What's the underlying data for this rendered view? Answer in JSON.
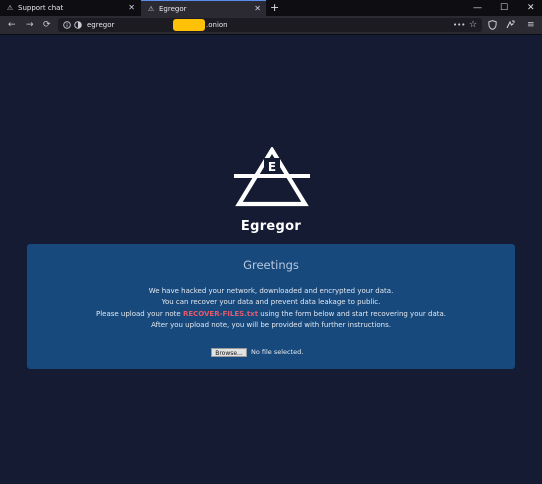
{
  "browser": {
    "tabs": [
      {
        "title": "Support chat",
        "icon": "warning-icon",
        "active": false
      },
      {
        "title": "Egregor",
        "icon": "warning-icon",
        "active": true
      }
    ],
    "new_tab_label": "+",
    "window_controls": {
      "minimize": "—",
      "maximize": "☐",
      "close": "✕"
    },
    "nav": {
      "back": "←",
      "forward": "→",
      "reload": "⟳",
      "menu": "≡",
      "more": "•••",
      "bookmark": "☆"
    },
    "url": {
      "prefix": "egregor",
      "suffix": ".onion",
      "redaction_color": "#ffc107"
    }
  },
  "page": {
    "brand": "Egregor",
    "logo_letter": "E",
    "panel": {
      "title": "Greetings",
      "lines": [
        "We have hacked your network, downloaded and encrypted your data.",
        "You can recover your data and prevent data leakage to public."
      ],
      "line3_before": "Please upload your note ",
      "line3_highlight": "RECOVER-FILES.txt",
      "line3_after": " using the form below and start recovering your data.",
      "line4": "After you upload note, you will be provided with further instructions.",
      "browse_label": "Browse...",
      "file_status": "No file selected."
    },
    "colors": {
      "background": "#141b33",
      "panel": "#17497c",
      "highlight": "#e8586a"
    }
  }
}
